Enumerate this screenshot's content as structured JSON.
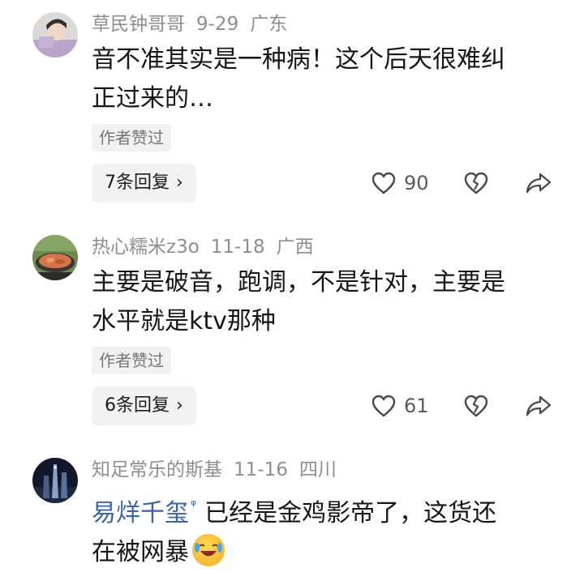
{
  "comments": [
    {
      "username": "草民钟哥哥",
      "date": "9-29",
      "location": "广东",
      "text_line1": "音不准其实是一种病！这个后天很难纠",
      "text_line2": "正过来的…",
      "author_liked": "作者赞过",
      "replies": "7条回复",
      "likes": "90"
    },
    {
      "username": "热心糯米z3o",
      "date": "11-18",
      "location": "广西",
      "text_line1": "主要是破音，跑调，不是针对，主要是",
      "text_line2": "水平就是ktv那种",
      "author_liked": "作者赞过",
      "replies": "6条回复",
      "likes": "61"
    },
    {
      "username": "知足常乐的斯基",
      "date": "11-16",
      "location": "四川",
      "mention": "易烊千玺",
      "text_line1": "已经是金鸡影帝了，这货还",
      "text_line2": "在被网暴",
      "emoji": "laughing-crying-emoji"
    }
  ],
  "icons": {
    "like": "heart-outline-icon",
    "dislike": "broken-heart-icon",
    "share": "share-arrow-icon",
    "chevron": "chevron-right-icon"
  },
  "colors": {
    "text": "#161616",
    "meta": "#8e8e8e",
    "mention": "#3a64a8",
    "chip_bg": "#f2f2f2"
  }
}
